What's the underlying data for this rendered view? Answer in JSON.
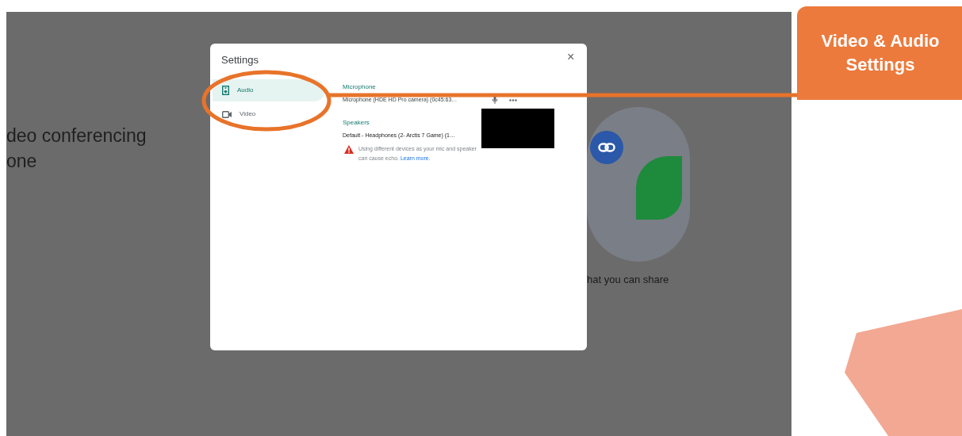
{
  "callout": {
    "title": "Video & Audio Settings"
  },
  "background_page": {
    "heading_lines": [
      "deo conferencing",
      "one"
    ],
    "share_title": "hat you can share"
  },
  "dialog": {
    "title": "Settings",
    "close": "×",
    "tabs": [
      {
        "label": "Audio",
        "kind": "audio",
        "selected": true
      },
      {
        "label": "Video",
        "kind": "video",
        "selected": false
      }
    ],
    "microphone": {
      "label": "Microphone",
      "value": "Microphone (HDE HD Pro camera) (0c45:63…"
    },
    "speakers": {
      "label": "Speakers",
      "value": "Default - Headphones (2- Arctis 7 Game) (1…"
    },
    "warning": {
      "text": "Using different devices as your mic and speaker can cause echo.",
      "link": "Learn more."
    }
  }
}
